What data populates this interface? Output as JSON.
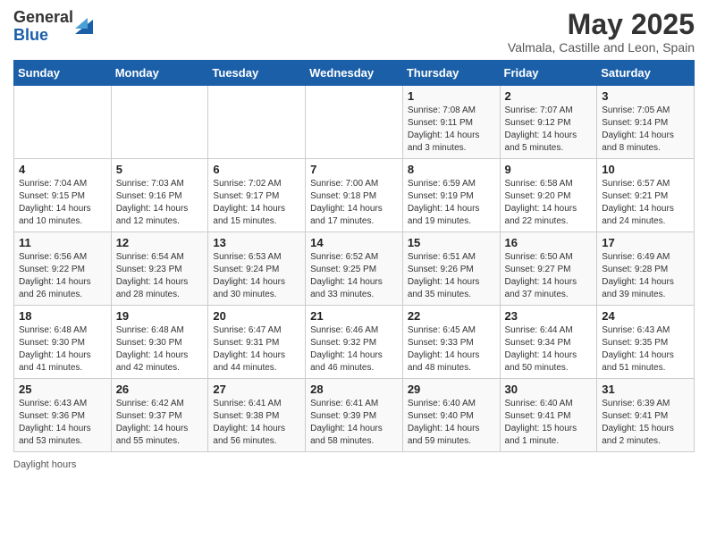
{
  "header": {
    "logo_general": "General",
    "logo_blue": "Blue",
    "month_title": "May 2025",
    "location": "Valmala, Castille and Leon, Spain"
  },
  "weekdays": [
    "Sunday",
    "Monday",
    "Tuesday",
    "Wednesday",
    "Thursday",
    "Friday",
    "Saturday"
  ],
  "weeks": [
    [
      {
        "day": "",
        "info": ""
      },
      {
        "day": "",
        "info": ""
      },
      {
        "day": "",
        "info": ""
      },
      {
        "day": "",
        "info": ""
      },
      {
        "day": "1",
        "info": "Sunrise: 7:08 AM\nSunset: 9:11 PM\nDaylight: 14 hours\nand 3 minutes."
      },
      {
        "day": "2",
        "info": "Sunrise: 7:07 AM\nSunset: 9:12 PM\nDaylight: 14 hours\nand 5 minutes."
      },
      {
        "day": "3",
        "info": "Sunrise: 7:05 AM\nSunset: 9:14 PM\nDaylight: 14 hours\nand 8 minutes."
      }
    ],
    [
      {
        "day": "4",
        "info": "Sunrise: 7:04 AM\nSunset: 9:15 PM\nDaylight: 14 hours\nand 10 minutes."
      },
      {
        "day": "5",
        "info": "Sunrise: 7:03 AM\nSunset: 9:16 PM\nDaylight: 14 hours\nand 12 minutes."
      },
      {
        "day": "6",
        "info": "Sunrise: 7:02 AM\nSunset: 9:17 PM\nDaylight: 14 hours\nand 15 minutes."
      },
      {
        "day": "7",
        "info": "Sunrise: 7:00 AM\nSunset: 9:18 PM\nDaylight: 14 hours\nand 17 minutes."
      },
      {
        "day": "8",
        "info": "Sunrise: 6:59 AM\nSunset: 9:19 PM\nDaylight: 14 hours\nand 19 minutes."
      },
      {
        "day": "9",
        "info": "Sunrise: 6:58 AM\nSunset: 9:20 PM\nDaylight: 14 hours\nand 22 minutes."
      },
      {
        "day": "10",
        "info": "Sunrise: 6:57 AM\nSunset: 9:21 PM\nDaylight: 14 hours\nand 24 minutes."
      }
    ],
    [
      {
        "day": "11",
        "info": "Sunrise: 6:56 AM\nSunset: 9:22 PM\nDaylight: 14 hours\nand 26 minutes."
      },
      {
        "day": "12",
        "info": "Sunrise: 6:54 AM\nSunset: 9:23 PM\nDaylight: 14 hours\nand 28 minutes."
      },
      {
        "day": "13",
        "info": "Sunrise: 6:53 AM\nSunset: 9:24 PM\nDaylight: 14 hours\nand 30 minutes."
      },
      {
        "day": "14",
        "info": "Sunrise: 6:52 AM\nSunset: 9:25 PM\nDaylight: 14 hours\nand 33 minutes."
      },
      {
        "day": "15",
        "info": "Sunrise: 6:51 AM\nSunset: 9:26 PM\nDaylight: 14 hours\nand 35 minutes."
      },
      {
        "day": "16",
        "info": "Sunrise: 6:50 AM\nSunset: 9:27 PM\nDaylight: 14 hours\nand 37 minutes."
      },
      {
        "day": "17",
        "info": "Sunrise: 6:49 AM\nSunset: 9:28 PM\nDaylight: 14 hours\nand 39 minutes."
      }
    ],
    [
      {
        "day": "18",
        "info": "Sunrise: 6:48 AM\nSunset: 9:30 PM\nDaylight: 14 hours\nand 41 minutes."
      },
      {
        "day": "19",
        "info": "Sunrise: 6:48 AM\nSunset: 9:30 PM\nDaylight: 14 hours\nand 42 minutes."
      },
      {
        "day": "20",
        "info": "Sunrise: 6:47 AM\nSunset: 9:31 PM\nDaylight: 14 hours\nand 44 minutes."
      },
      {
        "day": "21",
        "info": "Sunrise: 6:46 AM\nSunset: 9:32 PM\nDaylight: 14 hours\nand 46 minutes."
      },
      {
        "day": "22",
        "info": "Sunrise: 6:45 AM\nSunset: 9:33 PM\nDaylight: 14 hours\nand 48 minutes."
      },
      {
        "day": "23",
        "info": "Sunrise: 6:44 AM\nSunset: 9:34 PM\nDaylight: 14 hours\nand 50 minutes."
      },
      {
        "day": "24",
        "info": "Sunrise: 6:43 AM\nSunset: 9:35 PM\nDaylight: 14 hours\nand 51 minutes."
      }
    ],
    [
      {
        "day": "25",
        "info": "Sunrise: 6:43 AM\nSunset: 9:36 PM\nDaylight: 14 hours\nand 53 minutes."
      },
      {
        "day": "26",
        "info": "Sunrise: 6:42 AM\nSunset: 9:37 PM\nDaylight: 14 hours\nand 55 minutes."
      },
      {
        "day": "27",
        "info": "Sunrise: 6:41 AM\nSunset: 9:38 PM\nDaylight: 14 hours\nand 56 minutes."
      },
      {
        "day": "28",
        "info": "Sunrise: 6:41 AM\nSunset: 9:39 PM\nDaylight: 14 hours\nand 58 minutes."
      },
      {
        "day": "29",
        "info": "Sunrise: 6:40 AM\nSunset: 9:40 PM\nDaylight: 14 hours\nand 59 minutes."
      },
      {
        "day": "30",
        "info": "Sunrise: 6:40 AM\nSunset: 9:41 PM\nDaylight: 15 hours\nand 1 minute."
      },
      {
        "day": "31",
        "info": "Sunrise: 6:39 AM\nSunset: 9:41 PM\nDaylight: 15 hours\nand 2 minutes."
      }
    ]
  ],
  "footer": {
    "daylight_label": "Daylight hours"
  }
}
